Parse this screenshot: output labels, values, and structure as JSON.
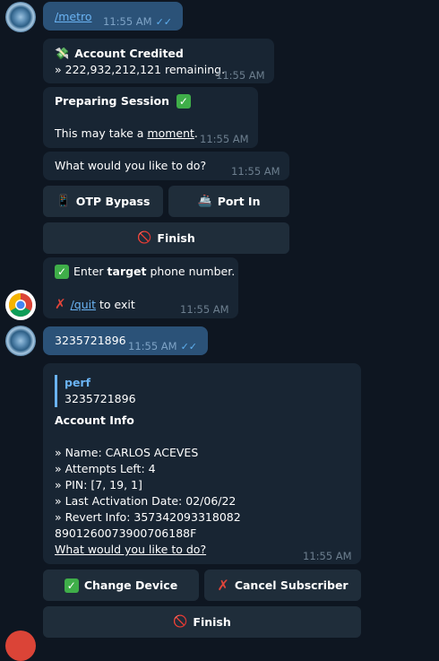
{
  "messages": {
    "m1": {
      "text": "/metro",
      "time": "11:55 AM"
    },
    "m2": {
      "title": "Account Credited",
      "line": "» 222,932,212,121 remaining.",
      "time": "11:55 AM"
    },
    "m3": {
      "title": "Preparing Session",
      "line_prefix": "This may take a ",
      "line_link": "moment",
      "line_suffix": ".",
      "time": "11:55 AM"
    },
    "m4": {
      "text": "What would you like to do?",
      "time": "11:55 AM"
    },
    "m5": {
      "line1_prefix": "Enter ",
      "line1_bold": "target",
      "line1_suffix": " phone number.",
      "quit_link": "/quit",
      "quit_suffix": " to exit",
      "time": "11:55 AM"
    },
    "m6": {
      "text": "3235721896",
      "time": "11:55 AM"
    },
    "m7": {
      "quote_title": "perf",
      "quote_text": "3235721896",
      "heading": "Account Info",
      "lines": [
        "» Name: CARLOS ACEVES",
        "» Attempts Left: 4",
        "» PIN: [7, 19, 1]",
        "» Last Activation Date: 02/06/22",
        "» Revert Info: 357342093318082 8901260073900706188F"
      ],
      "footer_link": "What would you like to do?",
      "time": "11:55 AM"
    }
  },
  "buttons": {
    "otp_bypass": "OTP Bypass",
    "port_in": "Port In",
    "finish_1": "Finish",
    "change_device": "Change Device",
    "cancel_subscriber": "Cancel Subscriber",
    "finish_2": "Finish"
  },
  "icons": {
    "money": "money-wings-icon",
    "check": "check-mark-icon",
    "phone": "mobile-phone-icon",
    "ship": "ship-icon",
    "no_entry": "prohibited-icon",
    "cross": "cross-mark-icon",
    "read_receipt": "double-check-icon",
    "chrome": "chrome-logo-icon"
  },
  "colors": {
    "background": "#0e1621",
    "incoming_bubble": "#182533",
    "outgoing_bubble": "#2b5278",
    "button": "#1f2d3a",
    "link": "#6ab3f3"
  }
}
